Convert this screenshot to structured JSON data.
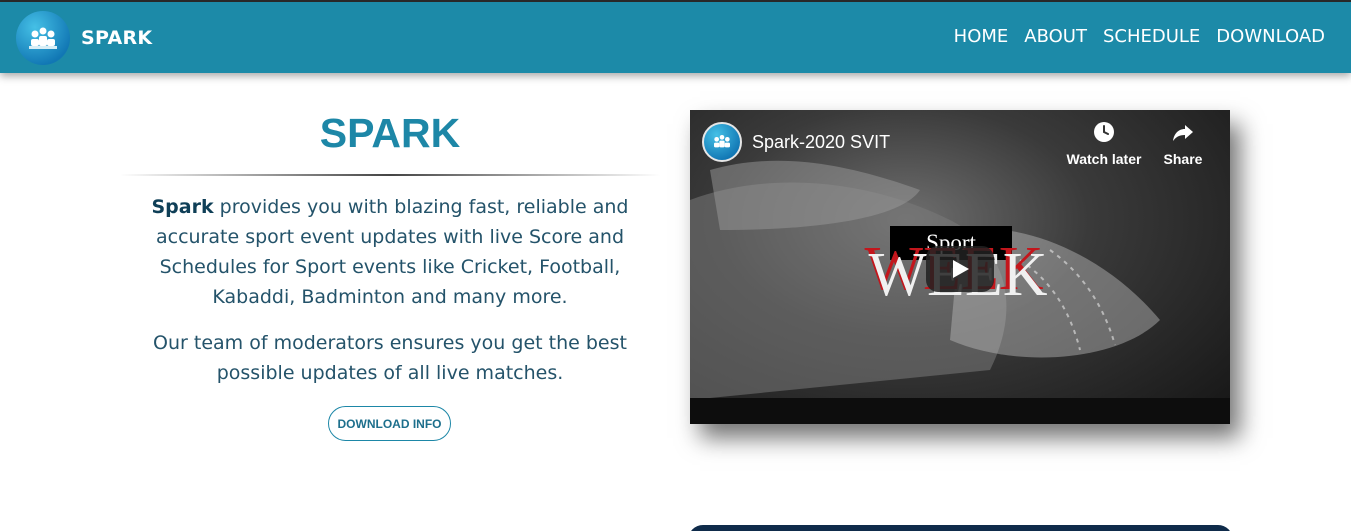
{
  "brand": {
    "name": "SPARK",
    "icon": "podium-people-icon"
  },
  "nav": {
    "links": [
      "HOME",
      "ABOUT",
      "SCHEDULE",
      "DOWNLOAD"
    ]
  },
  "hero": {
    "title": "SPARK",
    "para1_strong": "Spark",
    "para1_rest": " provides you with blazing fast, reliable and accurate sport event updates with live Score and Schedules for Sport events like Cricket, Football, Kabaddi, Badminton and many more.",
    "para2": "Our team of moderators ensures you get the best possible updates of all live matches.",
    "button": "DOWNLOAD INFO"
  },
  "video": {
    "title": "Spark-2020 SVIT",
    "watch_later": "Watch later",
    "share": "Share",
    "thumb_sport": "Sport",
    "thumb_week": "WEEK"
  },
  "colors": {
    "accent": "#1c8aa8",
    "text": "#24536a",
    "dark_bar": "#0f2b4a"
  }
}
